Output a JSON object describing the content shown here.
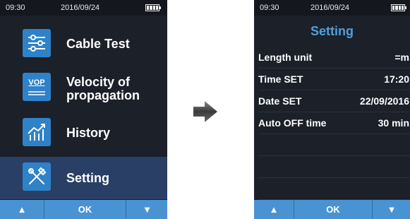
{
  "left_screen": {
    "status": {
      "time": "09:30",
      "date": "2016/09/24"
    },
    "menu": [
      {
        "icon": "sliders-icon",
        "label": "Cable Test",
        "selected": false
      },
      {
        "icon": "vop-icon",
        "icon_text": "VOP",
        "label_line1": "Velocity of",
        "label_line2": "propagation",
        "selected": false
      },
      {
        "icon": "chart-icon",
        "label": "History",
        "selected": false
      },
      {
        "icon": "tools-icon",
        "label": "Setting",
        "selected": true
      }
    ],
    "softkeys": {
      "up": "▲",
      "ok": "OK",
      "down": "▼"
    }
  },
  "arrow_icon": "right-arrow-icon",
  "right_screen": {
    "status": {
      "time": "09:30",
      "date": "2016/09/24"
    },
    "title": "Setting",
    "settings": [
      {
        "name": "Length unit",
        "value": "=m"
      },
      {
        "name": "Time SET",
        "value": "17:20"
      },
      {
        "name": "Date SET",
        "value": "22/09/2016"
      },
      {
        "name": "Auto OFF time",
        "value": "30 min"
      }
    ],
    "softkeys": {
      "up": "▲",
      "ok": "OK",
      "down": "▼"
    }
  },
  "colors": {
    "screen_bg": "#1c2029",
    "selected_bg": "#2a3f66",
    "icon_bg": "#2f82c8",
    "softkey_bg": "#4a93d3",
    "title_color": "#4ea0e0"
  }
}
